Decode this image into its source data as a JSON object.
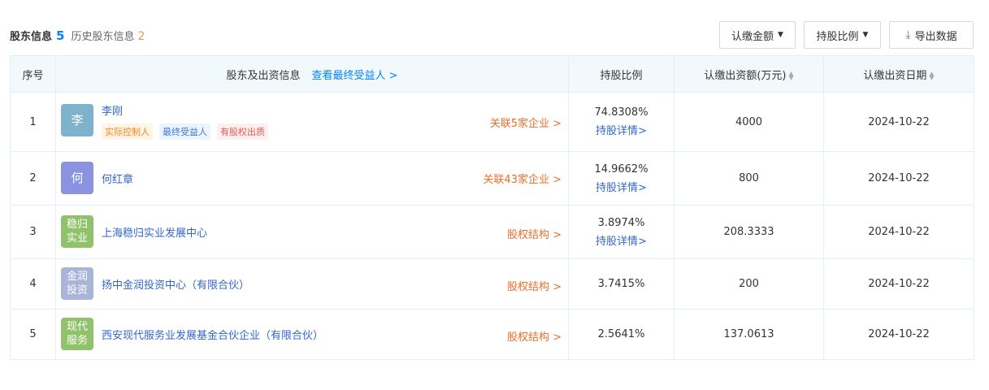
{
  "header": {
    "title": "股东信息",
    "count": "5",
    "history_label": "历史股东信息",
    "history_count": "2"
  },
  "toolbar": {
    "btn_amount": "认缴金额",
    "btn_ratio": "持股比例",
    "btn_export": "导出数据"
  },
  "table": {
    "headers": {
      "idx": "序号",
      "name": "股东及出资信息",
      "name_link": "查看最终受益人 >",
      "ratio": "持股比例",
      "amount": "认缴出资额(万元)",
      "date": "认缴出资日期"
    },
    "rows": [
      {
        "idx": "1",
        "avatar": "李",
        "avatar_color": "#7fb3cc",
        "name": "李刚",
        "tags": [
          "实际控制人",
          "最终受益人",
          "有股权出质"
        ],
        "related": "关联5家企业 >",
        "ratio": "74.8308%",
        "ratio_link": "持股详情>",
        "amount": "4000",
        "date": "2024-10-22"
      },
      {
        "idx": "2",
        "avatar": "何",
        "avatar_color": "#8b93e0",
        "name": "何红章",
        "related": "关联43家企业 >",
        "ratio": "14.9662%",
        "ratio_link": "持股详情>",
        "amount": "800",
        "date": "2024-10-22"
      },
      {
        "idx": "3",
        "avatar": "稳归\n实业",
        "avatar_color": "#8fc26b",
        "name": "上海稳归实业发展中心",
        "related": "股权结构 >",
        "ratio": "3.8974%",
        "ratio_link": "持股详情>",
        "amount": "208.3333",
        "date": "2024-10-22"
      },
      {
        "idx": "4",
        "avatar": "金润\n投资",
        "avatar_color": "#a8b4d8",
        "name": "扬中金润投资中心（有限合伙）",
        "related": "股权结构 >",
        "ratio": "3.7415%",
        "amount": "200",
        "date": "2024-10-22"
      },
      {
        "idx": "5",
        "avatar": "现代\n服务",
        "avatar_color": "#8fc26b",
        "name": "西安现代服务业发展基金合伙企业（有限合伙）",
        "related": "股权结构 >",
        "ratio": "2.5641%",
        "amount": "137.0613",
        "date": "2024-10-22"
      }
    ]
  }
}
